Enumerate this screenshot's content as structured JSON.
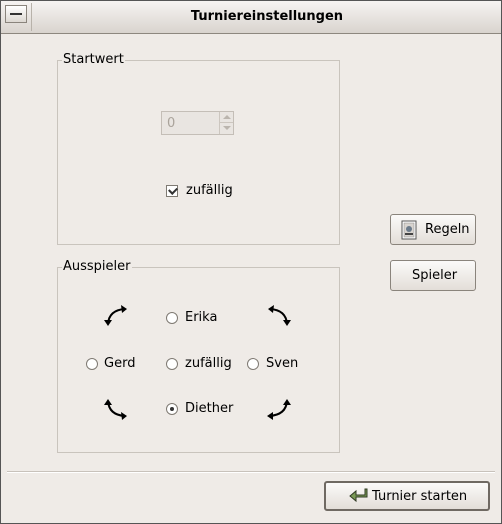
{
  "window": {
    "title": "Turniereinstellungen"
  },
  "startwert": {
    "group_label": "Startwert",
    "spin_value": "0",
    "random_label": "zufällig",
    "random_checked": true
  },
  "ausspieler": {
    "group_label": "Ausspieler",
    "options": [
      {
        "label": "Erika",
        "selected": false
      },
      {
        "label": "Gerd",
        "selected": false
      },
      {
        "label": "zufällig",
        "selected": false
      },
      {
        "label": "Sven",
        "selected": false
      },
      {
        "label": "Diether",
        "selected": true
      }
    ]
  },
  "buttons": {
    "rules": "Regeln",
    "players": "Spieler",
    "start": "Turnier starten"
  },
  "icons": {
    "menu": "window-menu-icon",
    "rules": "document-icon",
    "start": "start-arrow-icon",
    "rotate": "rotate-arrow-icon"
  }
}
